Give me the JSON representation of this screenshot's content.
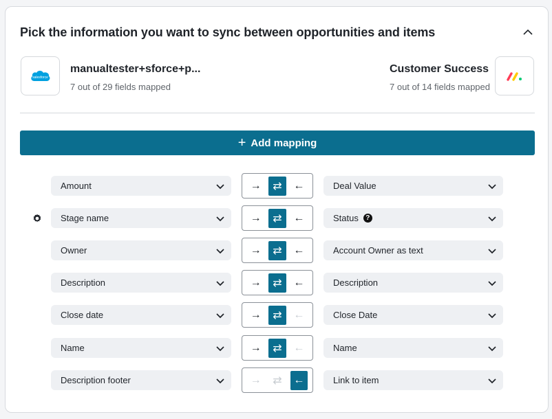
{
  "header": {
    "title": "Pick the information you want to sync between opportunities and items"
  },
  "source": {
    "name": "manualtester+sforce+p...",
    "fields_mapped": "7 out of 29 fields mapped",
    "logo_text": "salesforce"
  },
  "target": {
    "name": "Customer Success",
    "fields_mapped": "7 out of 14 fields mapped"
  },
  "add_mapping": {
    "label": "Add mapping"
  },
  "mappings": [
    {
      "left": "Amount",
      "right": "Deal Value",
      "direction": "both",
      "settings": false,
      "help": false
    },
    {
      "left": "Stage name",
      "right": "Status",
      "direction": "both",
      "settings": true,
      "help": true
    },
    {
      "left": "Owner",
      "right": "Account Owner as text",
      "direction": "both",
      "settings": false,
      "help": false
    },
    {
      "left": "Description",
      "right": "Description",
      "direction": "both",
      "settings": false,
      "help": false
    },
    {
      "left": "Close date",
      "right": "Close Date",
      "direction": "both",
      "settings": false,
      "help": false,
      "left_disabled": true
    },
    {
      "left": "Name",
      "right": "Name",
      "direction": "both",
      "settings": false,
      "help": false,
      "left_disabled": true
    },
    {
      "left": "Description footer",
      "right": "Link to item",
      "direction": "left",
      "settings": false,
      "help": false,
      "right_disabled": true,
      "both_disabled": true
    }
  ],
  "colors": {
    "accent": "#0b6e8f",
    "field_bg": "#eef0f3",
    "salesforce_blue": "#00a1e0"
  }
}
